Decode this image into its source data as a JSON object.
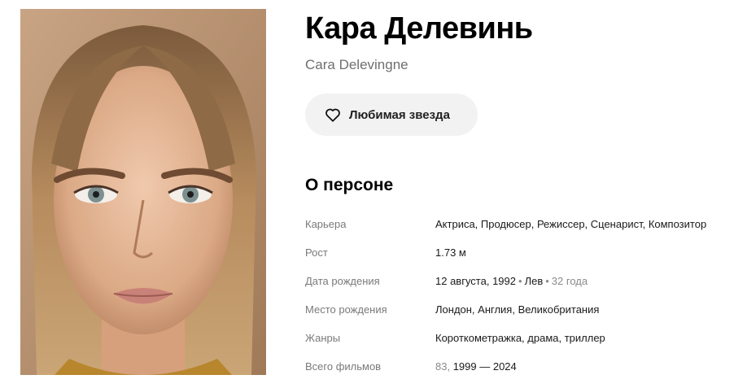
{
  "person": {
    "name": "Кара Делевинь",
    "original_name": "Cara Delevingne"
  },
  "favorite_button": {
    "label": "Любимая звезда",
    "icon": "heart-icon"
  },
  "about": {
    "title": "О персоне",
    "career": {
      "label": "Карьера",
      "value": "Актриса, Продюсер, Режиссер, Сценарист, Композитор"
    },
    "height": {
      "label": "Рост",
      "value": "1.73 м"
    },
    "birth_date": {
      "label": "Дата рождения",
      "date": "12 августа, 1992",
      "sign": "Лев",
      "age": "32 года"
    },
    "birth_place": {
      "label": "Место рождения",
      "value": "Лондон, Англия, Великобритания"
    },
    "genres": {
      "label": "Жанры",
      "value": "Короткометражка, драма, триллер"
    },
    "films": {
      "label": "Всего фильмов",
      "count": "83,",
      "years": "1999 — 2024"
    }
  },
  "colors": {
    "accent_text": "#000000",
    "muted_text": "#7a7a7a",
    "button_bg": "#f2f2f2"
  }
}
